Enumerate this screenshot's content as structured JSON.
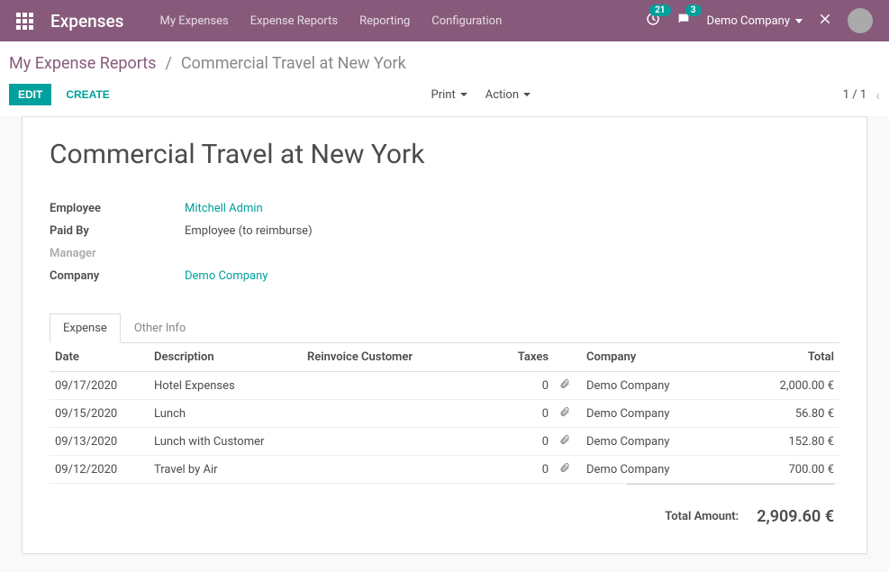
{
  "navbar": {
    "brand": "Expenses",
    "menu": [
      "My Expenses",
      "Expense Reports",
      "Reporting",
      "Configuration"
    ],
    "timer_badge": "21",
    "chat_badge": "3",
    "company": "Demo Company"
  },
  "breadcrumb": {
    "back": "My Expense Reports",
    "current": "Commercial Travel at New York"
  },
  "controls": {
    "edit": "EDIT",
    "create": "CREATE",
    "print": "Print",
    "action": "Action",
    "pager": "1 / 1"
  },
  "form": {
    "title": "Commercial Travel at New York",
    "fields": {
      "employee_label": "Employee",
      "employee_value": "Mitchell Admin",
      "paidby_label": "Paid By",
      "paidby_value": "Employee (to reimburse)",
      "manager_label": "Manager",
      "manager_value": "",
      "company_label": "Company",
      "company_value": "Demo Company"
    }
  },
  "tabs": {
    "expense": "Expense",
    "other": "Other Info"
  },
  "table": {
    "headers": {
      "date": "Date",
      "description": "Description",
      "reinvoice": "Reinvoice Customer",
      "taxes": "Taxes",
      "company": "Company",
      "total": "Total"
    },
    "rows": [
      {
        "date": "09/17/2020",
        "desc": "Hotel Expenses",
        "reinv": "",
        "tax": "0",
        "company": "Demo Company",
        "total": "2,000.00 €"
      },
      {
        "date": "09/15/2020",
        "desc": "Lunch",
        "reinv": "",
        "tax": "0",
        "company": "Demo Company",
        "total": "56.80 €"
      },
      {
        "date": "09/13/2020",
        "desc": "Lunch with Customer",
        "reinv": "",
        "tax": "0",
        "company": "Demo Company",
        "total": "152.80 €"
      },
      {
        "date": "09/12/2020",
        "desc": "Travel by Air",
        "reinv": "",
        "tax": "0",
        "company": "Demo Company",
        "total": "700.00 €"
      }
    ],
    "total_label": "Total Amount:",
    "total_value": "2,909.60 €"
  }
}
